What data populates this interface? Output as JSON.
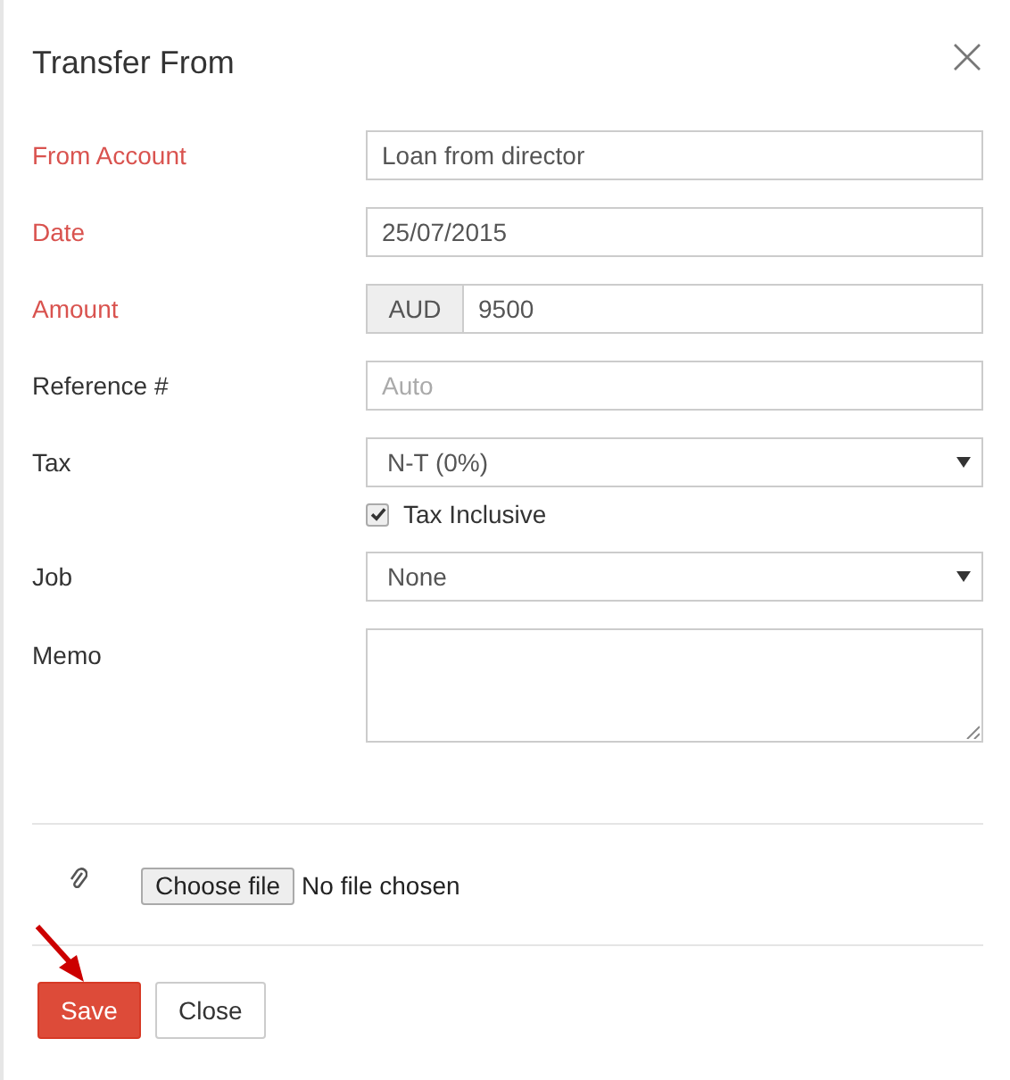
{
  "dialog": {
    "title": "Transfer From"
  },
  "fields": [
    {
      "kind": "text",
      "label": "From Account",
      "required": true,
      "value": "Loan from director"
    },
    {
      "kind": "text",
      "label": "Date",
      "required": true,
      "value": "25/07/2015"
    },
    {
      "kind": "addon",
      "label": "Amount",
      "required": true,
      "addon": "AUD",
      "value": "9500"
    },
    {
      "kind": "text",
      "label": "Reference #",
      "required": false,
      "placeholder": "Auto"
    },
    {
      "kind": "select",
      "label": "Tax",
      "required": false,
      "value": "N-T (0%)"
    },
    {
      "kind": "checkbox",
      "label": "Tax Inclusive",
      "checked": true
    },
    {
      "kind": "select",
      "label": "Job",
      "required": false,
      "value": "None"
    },
    {
      "kind": "textarea",
      "label": "Memo",
      "required": false
    }
  ],
  "attachment": {
    "button": "Choose file",
    "status": "No file chosen"
  },
  "buttons": [
    {
      "label": "Save",
      "kind": "primary"
    },
    {
      "label": "Close",
      "kind": "default"
    }
  ]
}
